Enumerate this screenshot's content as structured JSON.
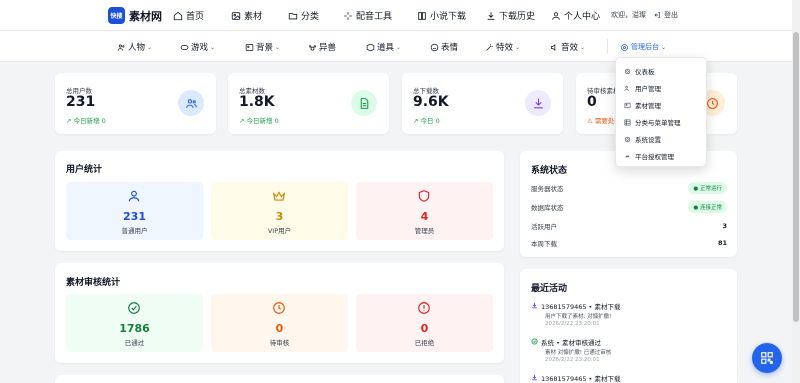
{
  "app": {
    "logo_badge": "快搜",
    "logo_text": "素材网"
  },
  "topnav": [
    {
      "label": "首页",
      "icon": "home-icon"
    },
    {
      "label": "素材",
      "icon": "image-icon"
    },
    {
      "label": "分类",
      "icon": "folder-icon"
    },
    {
      "label": "配音工具",
      "icon": "sparkle-icon"
    },
    {
      "label": "小说下载",
      "icon": "book-icon"
    },
    {
      "label": "下载历史",
      "icon": "download-icon"
    },
    {
      "label": "个人中心",
      "icon": "user-icon"
    }
  ],
  "user": {
    "greeting": "欢迎，溢璨",
    "logout_label": "登出"
  },
  "categories": [
    {
      "label": "人物",
      "icon": "users-icon",
      "dropdown": true
    },
    {
      "label": "游戏",
      "icon": "gamepad-icon",
      "dropdown": true
    },
    {
      "label": "背景",
      "icon": "image-icon",
      "dropdown": true
    },
    {
      "label": "异兽",
      "icon": "paw-icon",
      "dropdown": false
    },
    {
      "label": "道具",
      "icon": "box-icon",
      "dropdown": true
    },
    {
      "label": "表情",
      "icon": "smile-icon",
      "dropdown": false
    },
    {
      "label": "特效",
      "icon": "magic-icon",
      "dropdown": true
    },
    {
      "label": "音效",
      "icon": "sound-icon",
      "dropdown": true
    },
    {
      "label": "管理后台",
      "icon": "gear-icon",
      "dropdown": true
    }
  ],
  "stats": [
    {
      "label": "总用户数",
      "value": "231",
      "sub": "今日新增 0",
      "icon": "users-icon",
      "color": "#2563eb",
      "bg": "#dbeafe"
    },
    {
      "label": "总素材数",
      "value": "1.8K",
      "sub": "今日新增 0",
      "icon": "file-icon",
      "color": "#16a34a",
      "bg": "#dcfce7"
    },
    {
      "label": "总下载数",
      "value": "9.6K",
      "sub": "今日 0",
      "icon": "download-icon",
      "color": "#7c3aed",
      "bg": "#ede9fe"
    },
    {
      "label": "待审核素材",
      "value": "0",
      "sub": "需要处理",
      "icon": "clock-icon",
      "color": "#ea580c",
      "bg": "#ffedd5"
    }
  ],
  "user_stats": {
    "title": "用户统计",
    "tiles": [
      {
        "value": "231",
        "label": "普通用户",
        "icon": "user-icon",
        "color": "#1d4ed8",
        "bg": "#eff6ff"
      },
      {
        "value": "3",
        "label": "VIP用户",
        "icon": "crown-icon",
        "color": "#ca8a04",
        "bg": "#fefce8"
      },
      {
        "value": "4",
        "label": "管理员",
        "icon": "shield-icon",
        "color": "#dc2626",
        "bg": "#fef2f2"
      }
    ]
  },
  "review_stats": {
    "title": "素材审核统计",
    "tiles": [
      {
        "value": "1786",
        "label": "已通过",
        "icon": "check-icon",
        "color": "#15803d",
        "bg": "#f0fdf4"
      },
      {
        "value": "0",
        "label": "待审核",
        "icon": "clock-icon",
        "color": "#ea580c",
        "bg": "#fff7ed"
      },
      {
        "value": "0",
        "label": "已拒绝",
        "icon": "alert-icon",
        "color": "#dc2626",
        "bg": "#fef2f2"
      }
    ]
  },
  "system_status": {
    "title": "系统状态",
    "rows": [
      {
        "label": "服务器状态",
        "value": "正常运行",
        "pill": true
      },
      {
        "label": "数据库状态",
        "value": "连接正常",
        "pill": true
      },
      {
        "label": "活跃用户",
        "value": "3",
        "pill": false
      },
      {
        "label": "本周下载",
        "value": "81",
        "pill": false
      }
    ]
  },
  "recent_activity": {
    "title": "最近活动",
    "items": [
      {
        "title": "13681579465 • 素材下载",
        "desc": "用户下载了素材: 对慷扩撒!",
        "time": "2026/2/22 23:20:01",
        "icon": "download-icon",
        "color": "#7c3aed"
      },
      {
        "title": "系统 • 素材审核通过",
        "desc": "素材 对慷扩撒! 已通过审核",
        "time": "2026/2/22 23:20:01",
        "icon": "check-icon",
        "color": "#16a34a"
      },
      {
        "title": "13681579465 • 素材下载",
        "desc": "",
        "time": "",
        "icon": "download-icon",
        "color": "#7c3aed"
      }
    ]
  },
  "admin_menu": [
    {
      "label": "仪表板",
      "icon": "gear-icon"
    },
    {
      "label": "用户管理",
      "icon": "users-icon"
    },
    {
      "label": "素材管理",
      "icon": "image-icon"
    },
    {
      "label": "分类与菜单管理",
      "icon": "grid-icon"
    },
    {
      "label": "系统设置",
      "icon": "gear-icon"
    },
    {
      "label": "平台授权管理",
      "icon": "link-icon"
    }
  ]
}
